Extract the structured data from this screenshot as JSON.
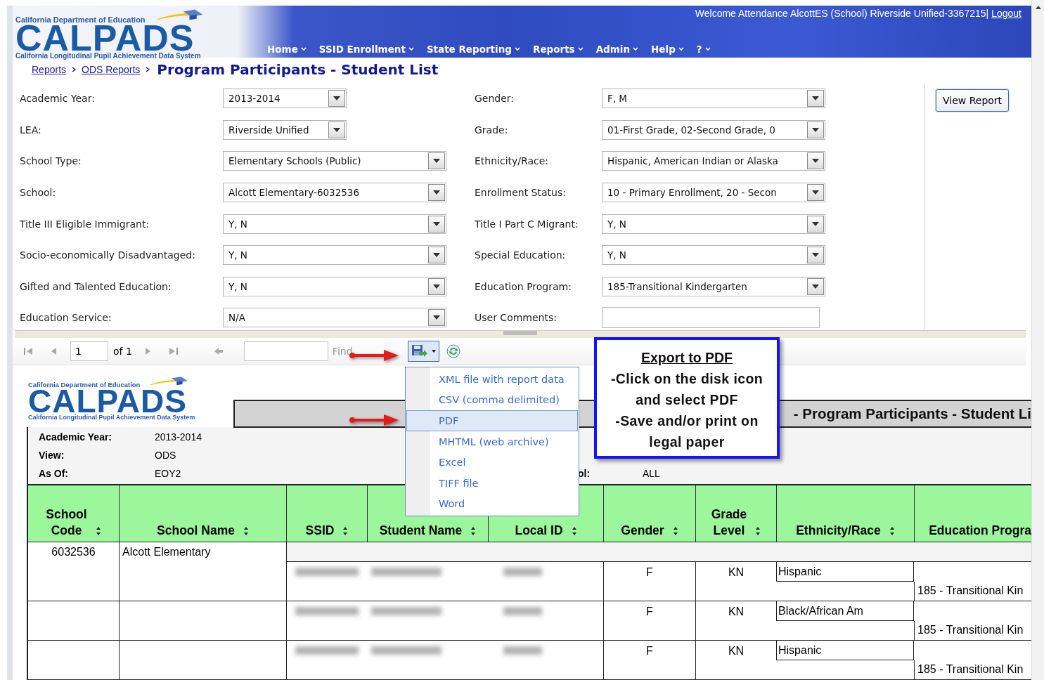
{
  "header": {
    "agency": "California Department of Education",
    "logo": "CALPADS",
    "logo_subtitle": "California Longitudinal Pupil Achievement Data System",
    "welcome": "Welcome Attendance AlcottES (School) Riverside Unified-3367215|",
    "logout": "Logout"
  },
  "nav": [
    {
      "label": "Home"
    },
    {
      "label": "SSID Enrollment"
    },
    {
      "label": "State Reporting"
    },
    {
      "label": "Reports"
    },
    {
      "label": "Admin"
    },
    {
      "label": "Help"
    },
    {
      "label": "?"
    }
  ],
  "breadcrumb": [
    "Reports",
    "ODS Reports"
  ],
  "page_title": "Program Participants - Student List",
  "filters": [
    {
      "label": "Academic Year:",
      "value": "2013-2014",
      "kind": "short"
    },
    {
      "label": "Gender:",
      "value": "F, M",
      "kind": "select"
    },
    {
      "label": "LEA:",
      "value": "Riverside Unified",
      "kind": "short"
    },
    {
      "label": "Grade:",
      "value": "01-First Grade, 02-Second Grade, 0",
      "kind": "select"
    },
    {
      "label": "School Type:",
      "value": "Elementary Schools (Public)",
      "kind": "select"
    },
    {
      "label": "Ethnicity/Race:",
      "value": "Hispanic, American Indian or Alaska",
      "kind": "select"
    },
    {
      "label": "School:",
      "value": "Alcott Elementary-6032536",
      "kind": "select"
    },
    {
      "label": "Enrollment Status:",
      "value": "10 - Primary Enrollment, 20 - Secon",
      "kind": "select"
    },
    {
      "label": "Title III Eligible Immigrant:",
      "value": "Y, N",
      "kind": "select"
    },
    {
      "label": "Title I Part C Migrant:",
      "value": "Y, N",
      "kind": "select"
    },
    {
      "label": "Socio-economically Disadvantaged:",
      "value": "Y, N",
      "kind": "select"
    },
    {
      "label": "Special Education:",
      "value": "Y, N",
      "kind": "select"
    },
    {
      "label": "Gifted and Talented Education:",
      "value": "Y, N",
      "kind": "select"
    },
    {
      "label": "Education Program:",
      "value": "185-Transitional Kindergarten",
      "kind": "select"
    },
    {
      "label": "Education Service:",
      "value": "N/A",
      "kind": "select"
    },
    {
      "label": "User Comments:",
      "kind": "text"
    }
  ],
  "view_report": "View Report",
  "toolbar": {
    "page": "1",
    "of": "of 1",
    "find": "Find"
  },
  "export_menu": [
    {
      "label": "XML file with report data",
      "selected": false
    },
    {
      "label": "CSV (comma delimited)",
      "selected": false
    },
    {
      "label": "PDF",
      "selected": true
    },
    {
      "label": "MHTML (web archive)",
      "selected": false
    },
    {
      "label": "Excel",
      "selected": false
    },
    {
      "label": "TIFF file",
      "selected": false
    },
    {
      "label": "Word",
      "selected": false
    }
  ],
  "callout": {
    "title": "Export to PDF",
    "lines": [
      "-Click on the disk icon",
      "and select PDF",
      "-Save and/or print on",
      "legal paper"
    ]
  },
  "report": {
    "agency": "California Department of Education",
    "logo": "CALPADS",
    "logo_subtitle": "California Longitudinal Pupil Achievement Data System",
    "title": "- Program Participants - Student Li",
    "info": [
      {
        "label": "Academic Year:",
        "value": "2013-2014"
      },
      {
        "label": "View:",
        "value": "ODS"
      },
      {
        "label": "As Of:",
        "value": "EOY2",
        "right_label": "ol:",
        "right_value": "ALL"
      }
    ],
    "columns": [
      "School\nCode",
      "School Name",
      "SSID",
      "Student Name",
      "Local ID",
      "Gender",
      "Grade\nLevel",
      "Ethnicity/Race",
      "Education Progra"
    ],
    "rows": [
      {
        "school_code": "6032536",
        "school_name": "Alcott Elementary",
        "gender": "F",
        "grade_level": "KN",
        "ethnicity": "Hispanic",
        "education_program": "185 - Transitional Kin"
      },
      {
        "gender": "F",
        "grade_level": "KN",
        "ethnicity": "Black/African Am",
        "education_program": "185 - Transitional Kin"
      },
      {
        "gender": "F",
        "grade_level": "KN",
        "ethnicity": "Hispanic",
        "education_program": "185 - Transitional Kin"
      }
    ]
  }
}
